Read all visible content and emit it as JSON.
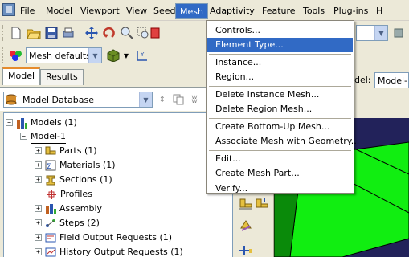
{
  "menubar": {
    "items": [
      {
        "label": "File"
      },
      {
        "label": "Model"
      },
      {
        "label": "Viewport"
      },
      {
        "label": "View"
      },
      {
        "label": "Seed"
      },
      {
        "label": "Mesh"
      },
      {
        "label": "Adaptivity"
      },
      {
        "label": "Feature"
      },
      {
        "label": "Tools"
      },
      {
        "label": "Plug-ins"
      },
      {
        "label": "H"
      }
    ]
  },
  "mesh_menu": {
    "items": [
      {
        "label": "Controls..."
      },
      {
        "label": "Element Type..."
      },
      {
        "label": "Instance..."
      },
      {
        "label": "Region..."
      },
      {
        "label": "Delete Instance Mesh..."
      },
      {
        "label": "Delete Region Mesh..."
      },
      {
        "label": "Create Bottom-Up Mesh..."
      },
      {
        "label": "Associate Mesh with Geometry..."
      },
      {
        "label": "Edit..."
      },
      {
        "label": "Create Mesh Part..."
      },
      {
        "label": "Verify..."
      }
    ]
  },
  "toolbar": {
    "mesh_defaults": "Mesh defaults",
    "number_3": "3",
    "number_4": "4",
    "model_label": "del:",
    "model_value": "Model-1"
  },
  "tabs": {
    "model": "Model",
    "results": "Results"
  },
  "database": {
    "value": "Model Database"
  },
  "tree": {
    "models": "Models (1)",
    "model1": "Model-1",
    "parts": "Parts (1)",
    "materials": "Materials (1)",
    "sections": "Sections (1)",
    "profiles": "Profiles",
    "assembly": "Assembly",
    "steps": "Steps (2)",
    "field_output": "Field Output Requests (1)",
    "history_output": "History Output Requests (1)"
  },
  "colors": {
    "accent": "#316ac5",
    "viewport_bg": "#22225a",
    "mesh_green": "#11ee11"
  }
}
